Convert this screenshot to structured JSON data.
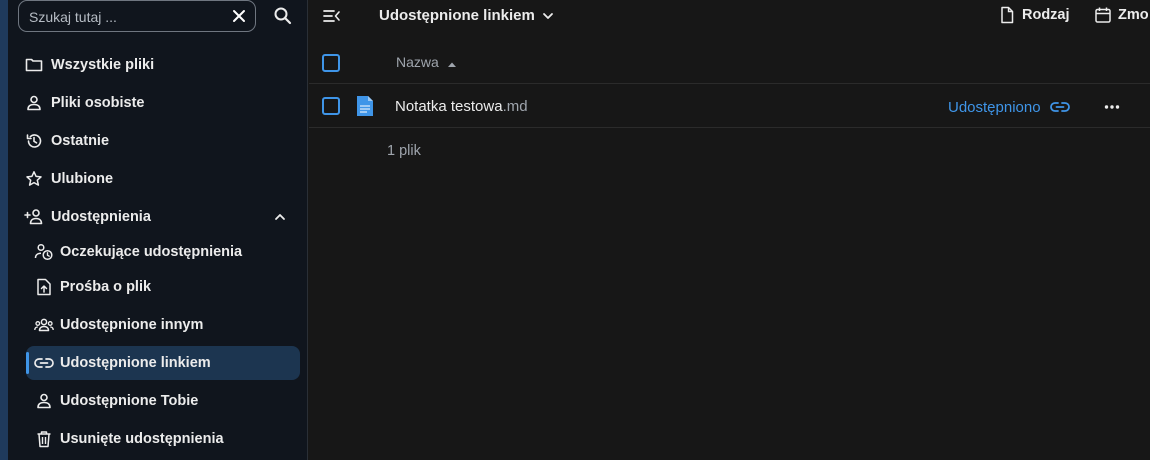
{
  "sidebar": {
    "search": {
      "placeholder": "Szukaj tutaj ..."
    },
    "items": [
      {
        "label": "Wszystkie pliki",
        "icon": "folder-icon"
      },
      {
        "label": "Pliki osobiste",
        "icon": "user-icon"
      },
      {
        "label": "Ostatnie",
        "icon": "history-icon"
      },
      {
        "label": "Ulubione",
        "icon": "star-icon"
      },
      {
        "label": "Udostępnienia",
        "icon": "share-account-icon",
        "expanded": true
      }
    ],
    "sub_items": [
      {
        "label": "Oczekujące udostępnienia",
        "icon": "pending-share-icon"
      },
      {
        "label": "Prośba o plik",
        "icon": "file-upload-icon"
      },
      {
        "label": "Udostępnione innym",
        "icon": "group-icon"
      },
      {
        "label": "Udostępnione linkiem",
        "icon": "link-icon",
        "active": true
      },
      {
        "label": "Udostępnione Tobie",
        "icon": "user-icon"
      },
      {
        "label": "Usunięte udostępnienia",
        "icon": "trash-icon"
      }
    ]
  },
  "topbar": {
    "view_title": "Udostępnione linkiem",
    "filters": [
      {
        "label": "Rodzaj",
        "icon": "file-icon"
      },
      {
        "label": "Zmo",
        "icon": "calendar-icon"
      }
    ]
  },
  "table": {
    "header": {
      "name": "Nazwa"
    },
    "rows": [
      {
        "name": "Notatka testowa",
        "ext": ".md",
        "share_status": "Udostępniono"
      }
    ],
    "summary": "1 plik"
  },
  "colors": {
    "accent": "#3f95e8",
    "sidebar_bg": "#10151d",
    "main_bg": "#171717",
    "active_bg": "#1c3550"
  }
}
